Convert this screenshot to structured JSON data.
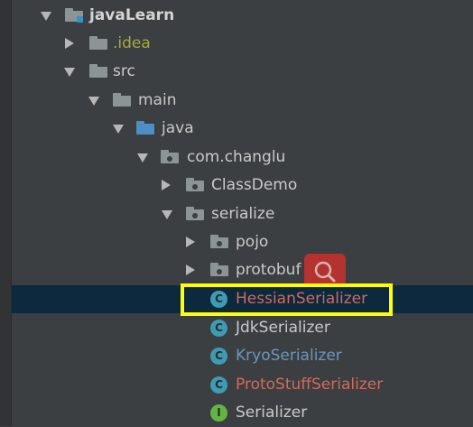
{
  "tree": {
    "root": {
      "label": "javaLearn",
      "color": "#d4d4d4"
    },
    "idea": {
      "label": ".idea",
      "color": "#a7a93c"
    },
    "src": {
      "label": "src",
      "color": "#c9c9c9"
    },
    "main": {
      "label": "main",
      "color": "#c9c9c9"
    },
    "java": {
      "label": "java",
      "color": "#c9c9c9"
    },
    "package": {
      "label": "com.changlu",
      "color": "#c9c9c9"
    },
    "classdemo": {
      "label": "ClassDemo",
      "color": "#c9c9c9"
    },
    "serialize": {
      "label": "serialize",
      "color": "#c9c9c9"
    },
    "pojo": {
      "label": "pojo",
      "color": "#c9c9c9"
    },
    "protobuf": {
      "label": "protobuf",
      "color": "#c9c9c9"
    },
    "hessian": {
      "label": "HessianSerializer",
      "color": "#d16a5b",
      "icon_letter": "C"
    },
    "jdk": {
      "label": "JdkSerializer",
      "color": "#c9c9c9",
      "icon_letter": "C"
    },
    "kryo": {
      "label": "KryoSerializer",
      "color": "#6897bb",
      "icon_letter": "C"
    },
    "protostuff": {
      "label": "ProtoStuffSerializer",
      "color": "#d16a5b",
      "icon_letter": "C"
    },
    "serializer": {
      "label": "Serializer",
      "color": "#c9c9c9",
      "icon_letter": "I"
    }
  },
  "colors": {
    "background": "#3c3f41",
    "selected_row": "#0d293e",
    "highlight_box": "#ffff00",
    "search_overlay": "#c9302c"
  },
  "icons": {
    "expand": "triangle-down-icon",
    "collapse": "triangle-right-icon",
    "folder": "folder-icon",
    "package": "package-icon",
    "class": "class-icon",
    "interface": "interface-icon",
    "search": "search-icon"
  }
}
